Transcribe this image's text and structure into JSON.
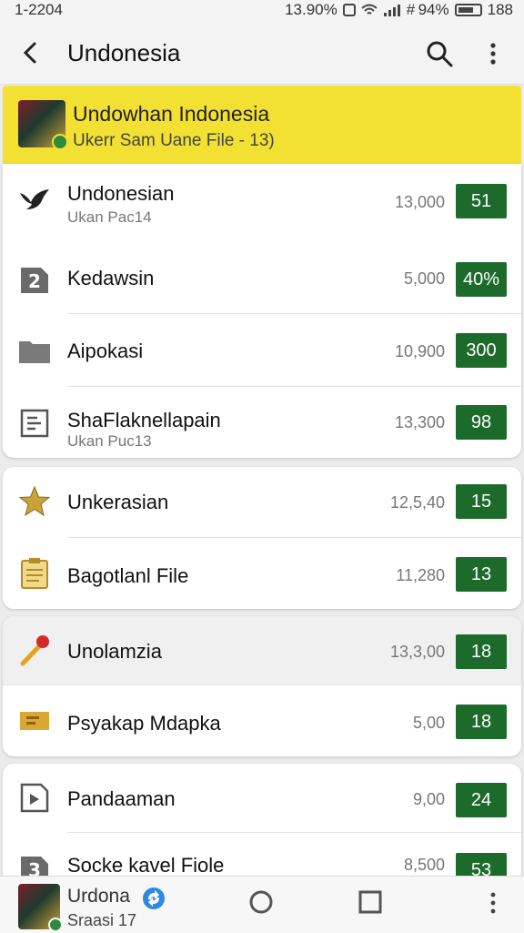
{
  "status": {
    "time": "1-2204",
    "right": "13.90%",
    "battery_text": "# 94%",
    "right_tail": "188"
  },
  "appbar": {
    "title": "Undonesia"
  },
  "banner": {
    "title": "Undowhan Indonesia",
    "subtitle": "Ukerr Sam Uane File - 13)"
  },
  "groups": [
    {
      "items": [
        {
          "icon": "bird-icon",
          "name": "Undonesian",
          "sub": "Ukan Pac14",
          "num": "13,000",
          "badge": "51"
        },
        {
          "icon": "number-two-icon",
          "name": "Kedawsin",
          "sub": "",
          "num": "5,000",
          "badge": "40%"
        },
        {
          "icon": "folder-icon",
          "name": "Aipokasi",
          "sub": "",
          "num": "10,900",
          "badge": "300"
        },
        {
          "icon": "document-icon",
          "name": "ShaFlaknellapain",
          "sub": "Ukan Puc13",
          "num": "13,300",
          "badge": "98"
        }
      ]
    },
    {
      "items": [
        {
          "icon": "star-icon",
          "name": "Unkerasian",
          "sub": "",
          "num": "12,5,40",
          "badge": "15"
        },
        {
          "icon": "clipboard-icon",
          "name": "Bagotlanl File",
          "sub": "",
          "num": "11,280",
          "badge": "13"
        }
      ]
    },
    {
      "items": [
        {
          "icon": "pin-icon",
          "name": "Unolamzia",
          "sub": "",
          "num": "13,3,00",
          "badge": "18"
        },
        {
          "icon": "ticket-icon",
          "name": "Psyakap Mdapka",
          "sub": "",
          "num": "5,00",
          "badge": "18"
        }
      ]
    },
    {
      "items": [
        {
          "icon": "media-icon",
          "name": "Pandaaman",
          "sub": "",
          "num": "9,00",
          "badge": "24"
        },
        {
          "icon": "number-three-icon",
          "name": "Socke kavel Fiole",
          "sub": "",
          "num": "8,500",
          "badge": "53"
        }
      ]
    }
  ],
  "bottom": {
    "name": "Urdona",
    "sub": "Sraasi 17"
  },
  "colors": {
    "banner": "#f2e033",
    "badge": "#1d6b2a"
  }
}
